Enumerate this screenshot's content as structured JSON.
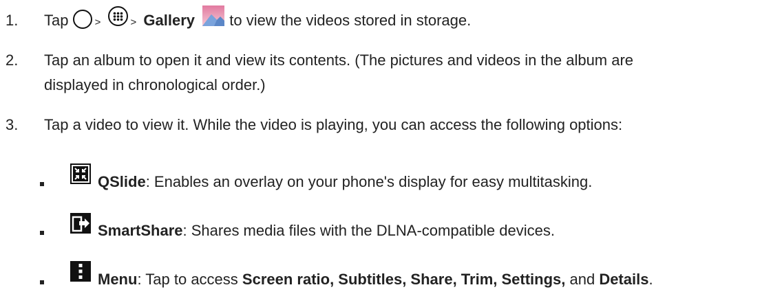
{
  "steps": [
    {
      "number": "1.",
      "prefix": "Tap",
      "sep1": ">",
      "sep2": ">",
      "bold": "Gallery",
      "suffix": "to view the videos stored in storage.",
      "icons": [
        "home-icon",
        "apps-icon",
        "gallery-icon"
      ]
    },
    {
      "number": "2.",
      "line1": "Tap an album to open it and view its contents. (The pictures and videos in the album are",
      "line2": "displayed in chronological order.)"
    },
    {
      "number": "3.",
      "text": "Tap a video to view it. While the video is playing, you can access the following options:"
    }
  ],
  "options": [
    {
      "icon": "qslide-icon",
      "bold": "QSlide",
      "text": ": Enables an overlay on your phone's display for easy multitasking."
    },
    {
      "icon": "smartshare-icon",
      "bold": "SmartShare",
      "text": ": Shares media files with the DLNA-compatible devices."
    },
    {
      "icon": "menu-icon",
      "bold": "Menu",
      "text": ": Tap to access ",
      "bold2": "Screen ratio, Subtitles, Share, Trim, Settings,",
      "text2": " and ",
      "bold3": "Details",
      "text3": "."
    }
  ],
  "colors": {
    "text": "#222222",
    "icon_dark": "#111111",
    "gallery_pink": "#e8a3b8",
    "gallery_blue": "#5b87c7"
  }
}
